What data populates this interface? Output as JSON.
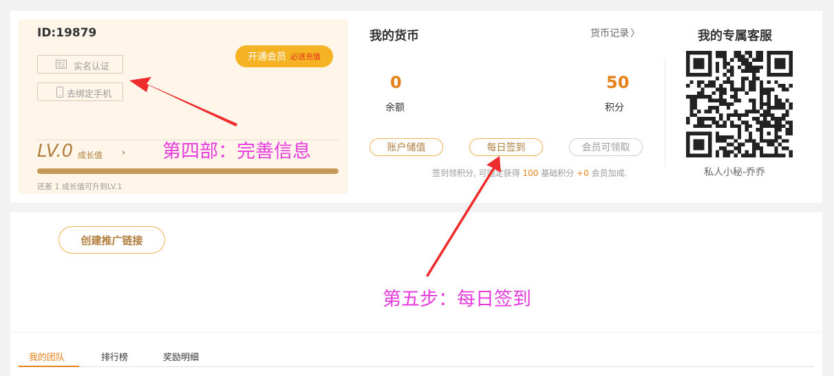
{
  "user": {
    "id": "ID:19879",
    "verify_label": "实名认证",
    "phone_label": "去绑定手机",
    "vip_label": "开通会员",
    "vip_sub": "必送充值",
    "level": "LV.0",
    "growth_label": "成长值",
    "growth_hint": "还差 1 成长值可升到LV.1",
    "growth_progress": 0
  },
  "currency": {
    "title": "我的货币",
    "record": "货币记录",
    "balance_value": "0",
    "balance_label": "余额",
    "points_value": "50",
    "points_label": "积分",
    "recharge": "账户储值",
    "sign": "每日签到",
    "member": "会员可领取",
    "hint_a": "签到领积分, 可固定获得",
    "hint_b": "100",
    "hint_c": "基础积分",
    "hint_d": "+0",
    "hint_e": "会员加成."
  },
  "service": {
    "title": "我的专属客服",
    "name": "私人小秘-乔乔"
  },
  "promo": {
    "create": "创建推广链接"
  },
  "tabs": [
    {
      "label": "我的团队"
    },
    {
      "label": "排行榜"
    },
    {
      "label": "奖励明细"
    }
  ],
  "annotations": {
    "step4": "第四部：完善信息",
    "step5": "第五步：每日签到"
  },
  "colors": {
    "accent": "#e8801a",
    "gold": "#b07d3c",
    "vip": "#f5b324",
    "annotation": "#e63bdc",
    "arrow": "#ee2c2c"
  }
}
